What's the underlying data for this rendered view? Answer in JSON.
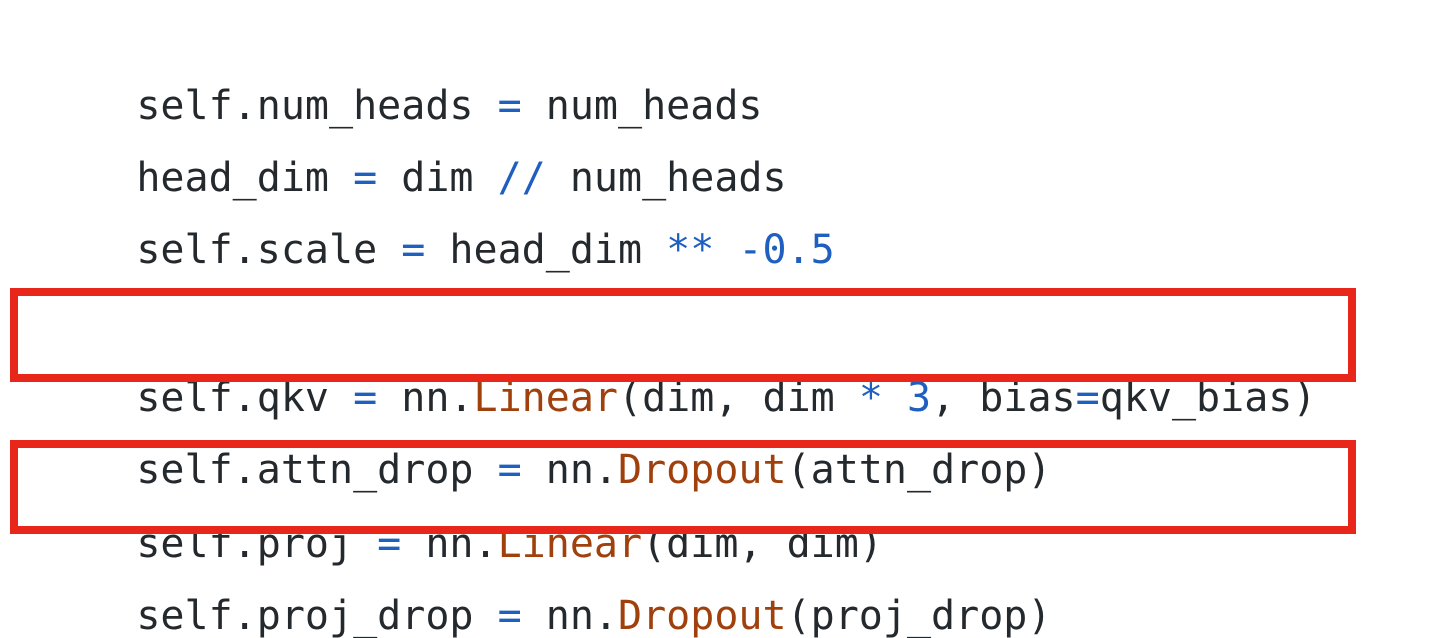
{
  "code": {
    "lines": [
      {
        "tokens": [
          {
            "text": "self.num_heads ",
            "kind": "plain"
          },
          {
            "text": "=",
            "kind": "op"
          },
          {
            "text": " num_heads",
            "kind": "plain"
          }
        ]
      },
      {
        "tokens": [
          {
            "text": "head_dim ",
            "kind": "plain"
          },
          {
            "text": "=",
            "kind": "op"
          },
          {
            "text": " dim ",
            "kind": "plain"
          },
          {
            "text": "//",
            "kind": "op"
          },
          {
            "text": " num_heads",
            "kind": "plain"
          }
        ]
      },
      {
        "tokens": [
          {
            "text": "self.scale ",
            "kind": "plain"
          },
          {
            "text": "=",
            "kind": "op"
          },
          {
            "text": " head_dim ",
            "kind": "plain"
          },
          {
            "text": "**",
            "kind": "op"
          },
          {
            "text": " ",
            "kind": "plain"
          },
          {
            "text": "-0.5",
            "kind": "num"
          }
        ]
      },
      {
        "tokens": [
          {
            "text": "self.qkv ",
            "kind": "plain"
          },
          {
            "text": "=",
            "kind": "op"
          },
          {
            "text": " nn.",
            "kind": "plain"
          },
          {
            "text": "Linear",
            "kind": "cls"
          },
          {
            "text": "(dim, dim ",
            "kind": "plain"
          },
          {
            "text": "*",
            "kind": "op"
          },
          {
            "text": " ",
            "kind": "plain"
          },
          {
            "text": "3",
            "kind": "num"
          },
          {
            "text": ", bias",
            "kind": "plain"
          },
          {
            "text": "=",
            "kind": "op"
          },
          {
            "text": "qkv_bias)",
            "kind": "plain"
          }
        ]
      },
      {
        "tokens": [
          {
            "text": "self.attn_drop ",
            "kind": "plain"
          },
          {
            "text": "=",
            "kind": "op"
          },
          {
            "text": " nn.",
            "kind": "plain"
          },
          {
            "text": "Dropout",
            "kind": "cls"
          },
          {
            "text": "(attn_drop)",
            "kind": "plain"
          }
        ]
      },
      {
        "tokens": [
          {
            "text": "self.proj ",
            "kind": "plain"
          },
          {
            "text": "=",
            "kind": "op"
          },
          {
            "text": " nn.",
            "kind": "plain"
          },
          {
            "text": "Linear",
            "kind": "cls"
          },
          {
            "text": "(dim, dim)",
            "kind": "plain"
          }
        ]
      },
      {
        "tokens": [
          {
            "text": "self.proj_drop ",
            "kind": "plain"
          },
          {
            "text": "=",
            "kind": "op"
          },
          {
            "text": " nn.",
            "kind": "plain"
          },
          {
            "text": "Dropout",
            "kind": "cls"
          },
          {
            "text": "(proj_drop)",
            "kind": "plain"
          }
        ]
      }
    ]
  },
  "colors": {
    "text": "#24292e",
    "operator": "#1f5fbf",
    "class_name": "#a0410d",
    "highlight_border": "#e8261a",
    "background": "#ffffff"
  }
}
